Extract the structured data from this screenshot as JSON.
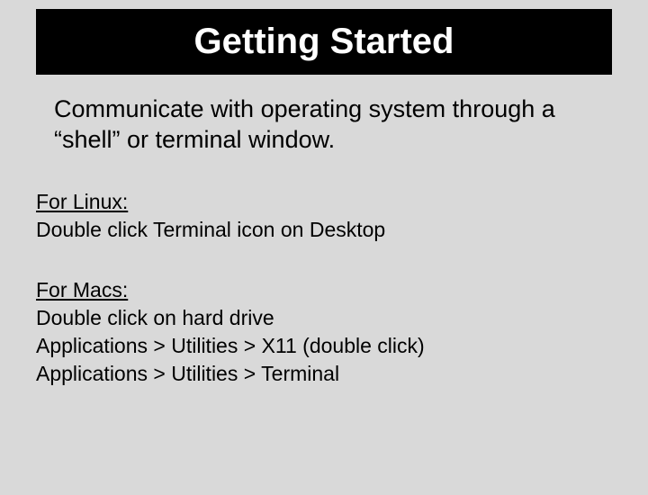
{
  "title": "Getting Started",
  "intro": "Communicate with operating system through a “shell” or terminal window.",
  "linux": {
    "head": "For Linux:",
    "line1": "Double click Terminal icon on Desktop"
  },
  "macs": {
    "head": "For Macs:",
    "line1": "Double click on hard drive",
    "line2": "Applications > Utilities > X11 (double click)",
    "line3": "Applications > Utilities > Terminal"
  }
}
